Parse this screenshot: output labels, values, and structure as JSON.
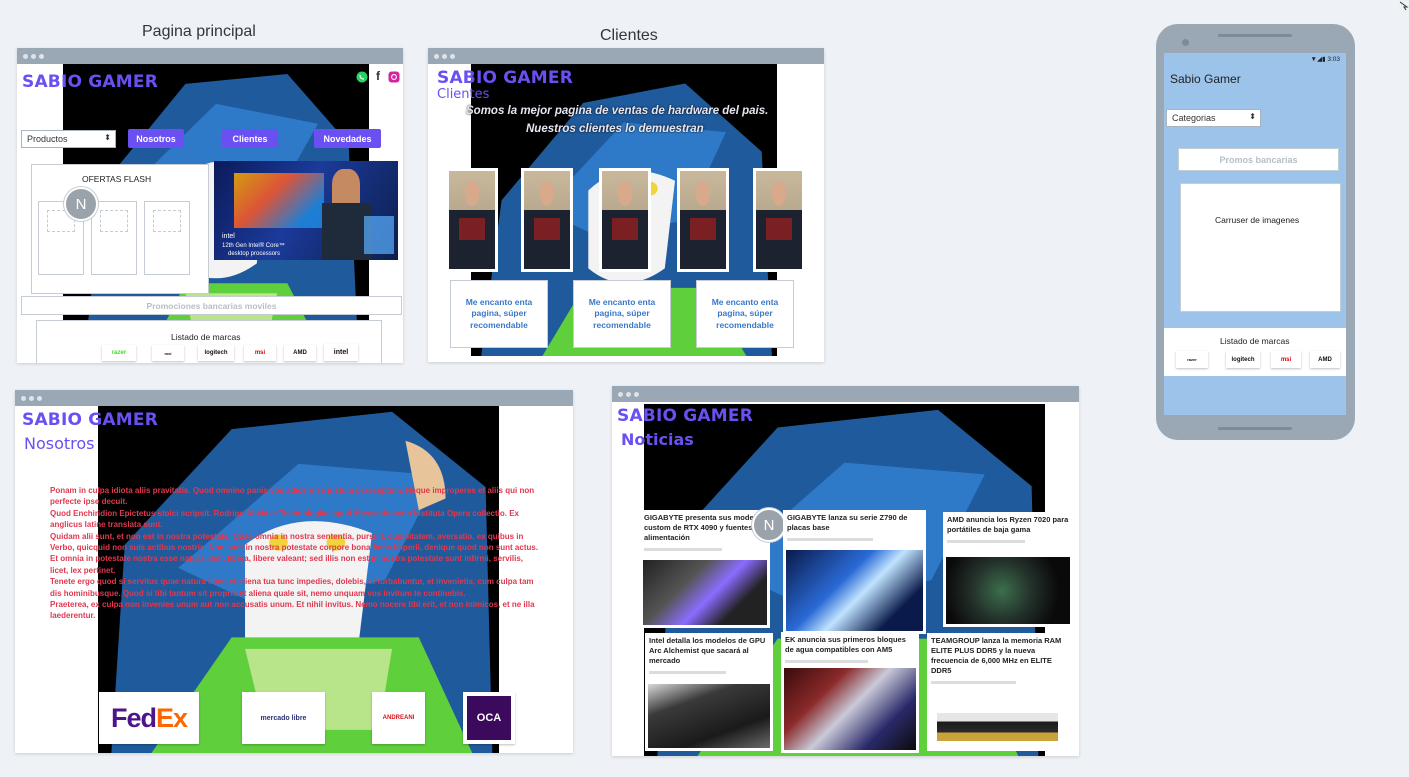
{
  "captions": {
    "home": "Pagina principal",
    "clients": "Clientes"
  },
  "colors": {
    "brand": "#6a4ff2",
    "frame_bar": "#9aa7b4",
    "mobile_bg": "#9cc3ea",
    "body_text_red": "#e0384f",
    "review_blue": "#3a79c9"
  },
  "home": {
    "brand": "SABIO GAMER",
    "social_icons": [
      "whatsapp-icon",
      "facebook-icon",
      "instagram-icon"
    ],
    "products_select": "Productos",
    "nav": [
      "Nosotros",
      "Clientes",
      "Novedades"
    ],
    "offers_title": "OFERTAS FLASH",
    "avatar_letter": "N",
    "promo_bar": "Promociones bancarias moviles",
    "brands_title": "Listado de marcas",
    "brands": [
      "razer",
      "msi",
      "logitech",
      "msi",
      "AMD",
      "intel"
    ],
    "banner_text_1": "intel",
    "banner_text_2": "12th Gen Intel® Core™",
    "banner_text_3": "desktop processors"
  },
  "clients": {
    "brand": "SABIO GAMER",
    "subtitle": "Clientes",
    "headline_1": "Somos la mejor pagina de ventas de hardware del pais.",
    "headline_2": "Nuestros clientes lo demuestran",
    "reviews": [
      "Me encanto enta pagina, súper recomendable",
      "Me encanto enta pagina, súper recomendable",
      "Me encanto enta pagina, súper recomendable"
    ]
  },
  "mobile": {
    "time": "3:03",
    "app_title": "Sabio Gamer",
    "categories_select": "Categorias",
    "promo_label": "Promos bancarias",
    "carousel_label": "Carruser de imagenes",
    "brands_title": "Listado de marcas",
    "brands": [
      "razer",
      "logitech",
      "msi",
      "AMD"
    ]
  },
  "about": {
    "brand": "SABIO GAMER",
    "subtitle": "Nosotros",
    "paragraph": "Ponam in culpa idiota aliis pravitatis. Quod omnino panis vos adicere se justum praeceptum. Neque improperes et aliis qui non perfecte ipse decuit.\nQuod Enchiridion Epictetus stoici scripsit. Rodrigo Abela et Technologiae apud Massachusetts Instituta Opera collectio. Ex anglicus latine translata sunt.\nQuidam alii sunt, et non est in nostra potestate. Quae omnia in nostra sententia, pursuit, cupiditatem, aversatio, ex quibus in Verbo, quicquid non suis actibus nostris. Non sunt in nostra potestate corpore bona fama imperii, denique quod non sunt actus.\nEt omnia in potestate nostra esse natura liber, libera, libere valeant; sed illis non est in nostra potestate sunt infirmi, servilis, licet, lex pertinet.\nTenete ergo quod si servitus quae natura liber, et aliena tua tunc impedies, dolebis, et turbabuntur, et invenietis, cum culpa tam dis hominibusque. Quod si tibi tantum sit propria et aliena quale sit, nemo unquam vos invitum te continebis.\nPraeterea, ex culpa non invenies unum aut non accusatis unum. Et nihil invitus. Nemo nocere tibi erit, et non inimicos, et ne illa laederentur.",
    "shipping_logos": [
      "FedEx",
      "mercado libre",
      "ANDREANI",
      "OCA"
    ]
  },
  "news": {
    "brand": "SABIO GAMER",
    "subtitle": "Noticias",
    "avatar_letter": "N",
    "articles": [
      "GIGABYTE presenta sus modelos custom de RTX 4090 y fuentes de alimentación",
      "GIGABYTE lanza su serie Z790 de placas base",
      "AMD anuncia los Ryzen 7020 para portátiles de baja gama",
      "Intel detalla los modelos de GPU Arc Alchemist que sacará al mercado",
      "EK anuncia sus primeros bloques de agua compatibles con AM5",
      "TEAMGROUP lanza la memoria RAM ELITE PLUS DDR5 y la nueva frecuencia de 6,000 MHz en ELITE DDR5"
    ]
  }
}
